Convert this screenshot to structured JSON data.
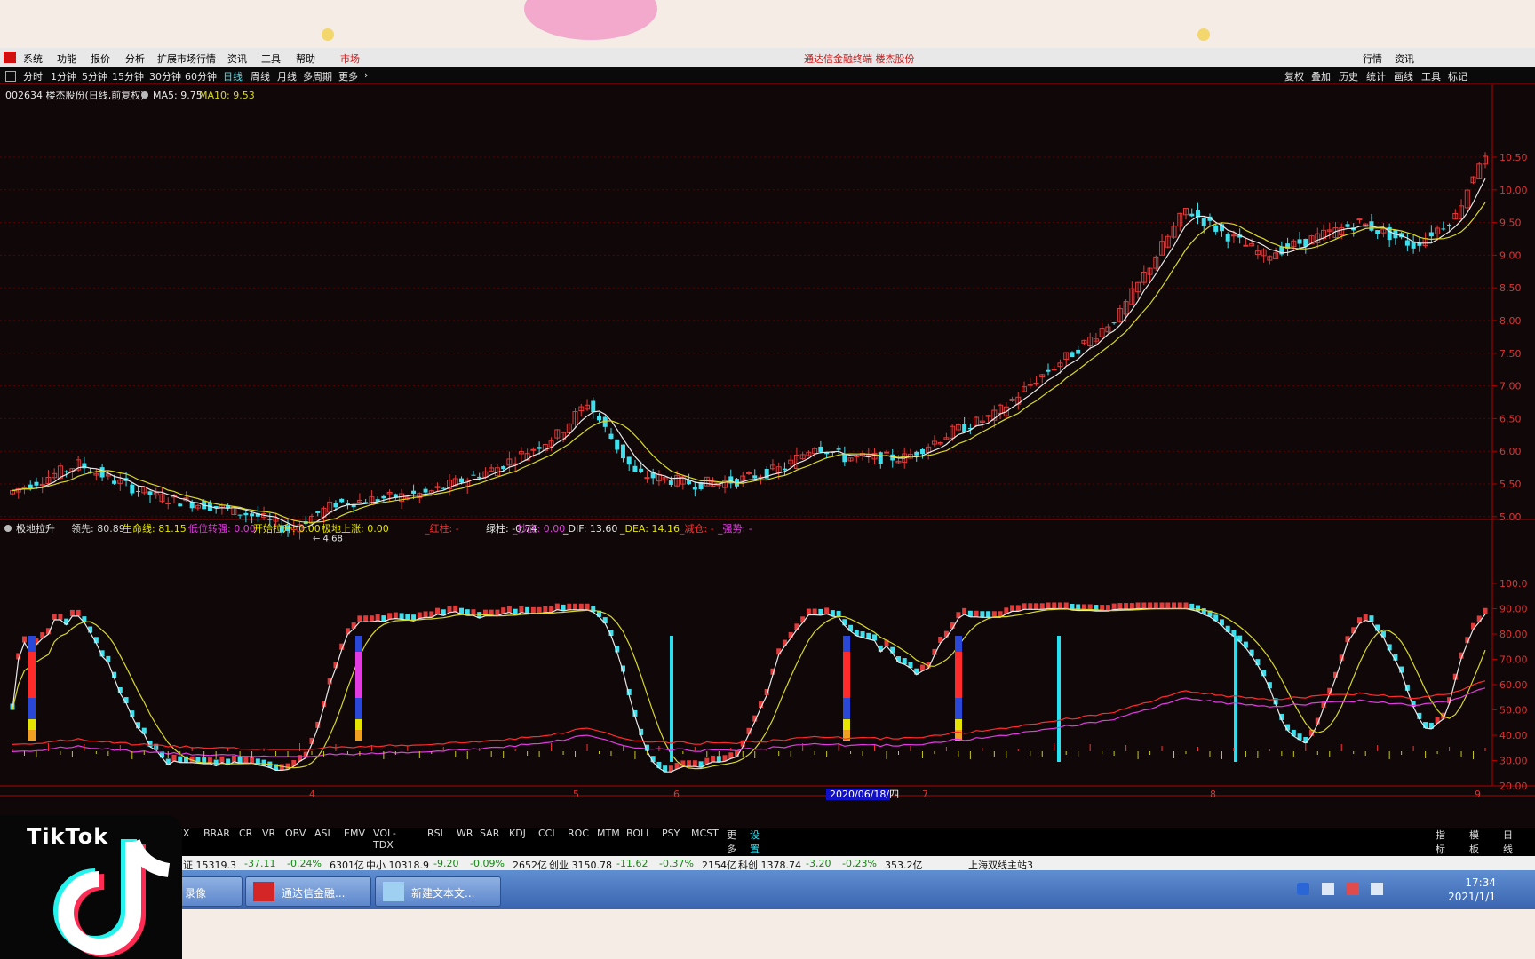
{
  "menubar": {
    "items": [
      "系统",
      "功能",
      "报价",
      "分析",
      "扩展市场行情",
      "资讯",
      "工具",
      "帮助",
      "市场"
    ],
    "title": "通达信金融终端  楼杰股份",
    "right_buttons": [
      "行情",
      "资讯"
    ]
  },
  "periods": {
    "items": [
      "分时",
      "1分钟",
      "5分钟",
      "15分钟",
      "30分钟",
      "60分钟",
      "日线",
      "周线",
      "月线",
      "多周期",
      "更多"
    ],
    "active": "日线",
    "right_items": [
      "复权",
      "叠加",
      "历史",
      "统计",
      "画线",
      "工具",
      "标记"
    ]
  },
  "main_chart": {
    "header_code": "002634 楼杰股份(日线,前复权)",
    "ma5_label": "MA5: 9.75",
    "ma10_label": "MA10: 9.53",
    "y_ticks": [
      "10.50",
      "10.00",
      "9.50",
      "9.00",
      "8.50",
      "8.00",
      "7.50",
      "7.00",
      "6.50",
      "6.00",
      "5.50",
      "5.00"
    ],
    "low_marker": "4.68"
  },
  "indicator": {
    "name": "极地拉升",
    "items": [
      {
        "label": "领先: 80.89",
        "color": "#d4d4d4"
      },
      {
        "label": "生命线: 81.15",
        "color": "#e5e500"
      },
      {
        "label": "低位转强: 0.00",
        "color": "#e23be2"
      },
      {
        "label": "开始拉升: 0.00",
        "color": "#e5e500"
      },
      {
        "label": "极地上涨: 0.00",
        "color": "#e5e500"
      },
      {
        "label": "_红柱: -",
        "color": "#ff3030"
      },
      {
        "label": "绿柱: -0.74",
        "color": "#e5e5e5"
      },
      {
        "label": "_抄底: 0.00",
        "color": "#e23be2"
      },
      {
        "label": "_DIF: 13.60",
        "color": "#e5e5e5"
      },
      {
        "label": "_DEA: 14.16",
        "color": "#e5e500"
      },
      {
        "label": "_减仓: -",
        "color": "#ff3030"
      },
      {
        "label": "_强势: -",
        "color": "#e23be2"
      }
    ],
    "y_ticks": [
      "100.0",
      "90.00",
      "80.00",
      "70.00",
      "60.00",
      "50.00",
      "40.00",
      "30.00",
      "20.00"
    ]
  },
  "x_axis": {
    "labels": [
      "4",
      "5",
      "6",
      "7",
      "8",
      "9"
    ],
    "selected_date": "2020/06/18/四"
  },
  "tabs": {
    "items": [
      "PIX",
      "BRAR",
      "CR",
      "VR",
      "OBV",
      "ASI",
      "EMV",
      "VOL-TDX",
      "RSI",
      "WR",
      "SAR",
      "KDJ",
      "CCI",
      "ROC",
      "MTM",
      "BOLL",
      "PSY",
      "MCST",
      "更多",
      "设置"
    ],
    "right": [
      "指标B",
      "模板",
      "日线"
    ]
  },
  "index_bar": {
    "items": [
      {
        "text": "证 15319.3",
        "color": "#111"
      },
      {
        "text": "-37.11",
        "color": "#118811"
      },
      {
        "text": "-0.24%",
        "color": "#118811"
      },
      {
        "text": "6301亿",
        "color": "#111"
      },
      {
        "text": "中小 10318.9",
        "color": "#111"
      },
      {
        "text": "-9.20",
        "color": "#118811"
      },
      {
        "text": "-0.09%",
        "color": "#118811"
      },
      {
        "text": "2652亿",
        "color": "#111"
      },
      {
        "text": "创业 3150.78",
        "color": "#111"
      },
      {
        "text": "-11.62",
        "color": "#118811"
      },
      {
        "text": "-0.37%",
        "color": "#118811"
      },
      {
        "text": "2154亿",
        "color": "#111"
      },
      {
        "text": "科创 1378.74",
        "color": "#111"
      },
      {
        "text": "-3.20",
        "color": "#118811"
      },
      {
        "text": "-0.23%",
        "color": "#118811"
      },
      {
        "text": "353.2亿",
        "color": "#111"
      },
      {
        "text": "上海双线主站3",
        "color": "#111"
      }
    ]
  },
  "taskbar": {
    "tasks": [
      "录像",
      "通达信金融...",
      "新建文本文..."
    ],
    "time": "17:34",
    "date": "2021/1/1"
  },
  "overlay": {
    "tiktok": "TikTok"
  },
  "colors": {
    "up": "#e03a3a",
    "down": "#3fe0ee",
    "ma5": "#e8e8e8",
    "ma10": "#d8d828",
    "axis_red": "#b00000"
  }
}
